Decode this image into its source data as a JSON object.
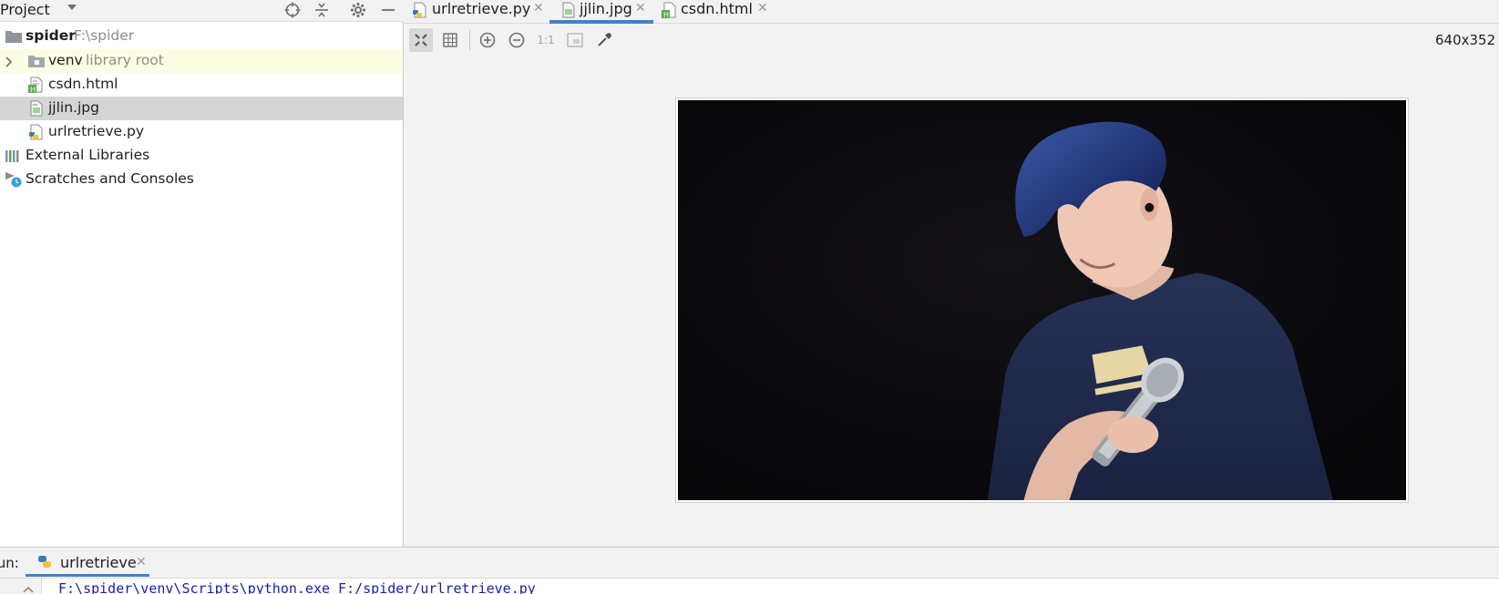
{
  "project_panel": {
    "title": "Project",
    "header_icons": [
      "locate-icon",
      "collapse-icon",
      "gear-icon",
      "minimize-icon"
    ],
    "tree": {
      "root": {
        "name": "spider",
        "path": "F:\\spider"
      },
      "venv": {
        "name": "venv",
        "hint": "library root"
      },
      "files": [
        {
          "name": "csdn.html",
          "icon": "html-file-icon"
        },
        {
          "name": "jjlin.jpg",
          "icon": "image-file-icon",
          "selected": true
        },
        {
          "name": "urlretrieve.py",
          "icon": "python-file-icon"
        }
      ],
      "external_libraries": "External Libraries",
      "scratches": "Scratches and Consoles"
    }
  },
  "editor": {
    "tabs": [
      {
        "label": "urlretrieve.py",
        "icon": "python-file-icon",
        "active": false
      },
      {
        "label": "jjlin.jpg",
        "icon": "image-file-icon",
        "active": true
      },
      {
        "label": "csdn.html",
        "icon": "html-file-icon",
        "active": false
      }
    ],
    "toolbar": {
      "buttons": [
        "fit-to-window-icon",
        "grid-icon",
        "zoom-in-icon",
        "zoom-out-icon",
        "actual-size",
        "background-icon",
        "color-picker-icon"
      ],
      "actual_size_label": "1:1"
    },
    "image_dimensions": "640x352 JPG",
    "image_name": "jjlin.jpg"
  },
  "run_panel": {
    "label": "Run:",
    "tab_label": "urlretrieve",
    "console_line": "F:\\spider\\venv\\Scripts\\python.exe F:/spider/urlretrieve.py"
  },
  "colors": {
    "accent": "#4083c9",
    "selection": "#d5d5d5",
    "library_highlight": "#fdfde3",
    "console_text": "#1a1ab0"
  }
}
